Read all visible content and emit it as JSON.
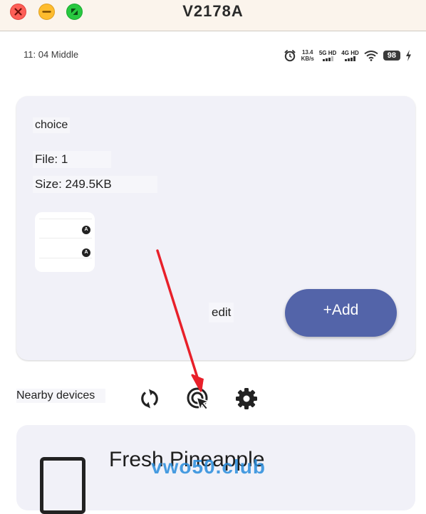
{
  "window": {
    "title": "V2178A"
  },
  "status": {
    "time": "11: 04 Middle",
    "speed_value": "13.4",
    "speed_unit": "KB/s",
    "net1": "5G HD",
    "net2": "4G HD",
    "battery": "98",
    "icons": [
      "alarm-icon",
      "wifi-icon",
      "charging-icon"
    ]
  },
  "card": {
    "choice_label": "choice",
    "file_label": "File: 1",
    "size_label": "Size: 249.5KB",
    "edit_label": "edit",
    "add_label": "+Add"
  },
  "thumbnail": {
    "avatar_letter": "A"
  },
  "nearby": {
    "label": "Nearby devices",
    "icons": [
      "refresh-icon",
      "touch-target-icon",
      "settings-gear-icon"
    ]
  },
  "device": {
    "name": "Fresh Pineapple"
  },
  "watermark": "vwo50.club",
  "colors": {
    "accent": "#5364a9",
    "card_bg": "#f1f1f8",
    "arrow": "#e8202a"
  }
}
